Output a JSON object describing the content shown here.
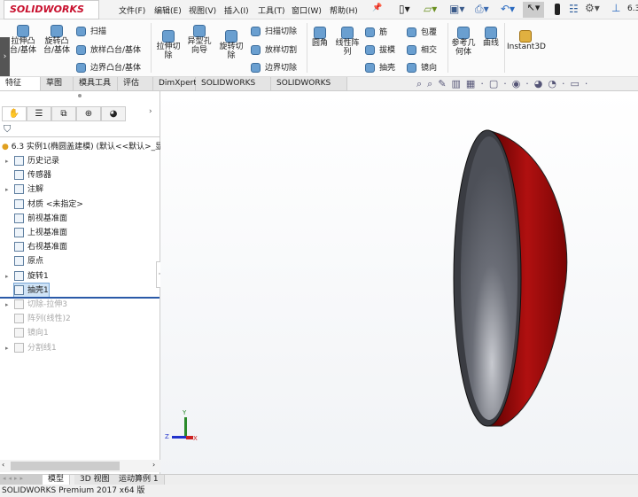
{
  "app": {
    "logo": "SOLIDWORKS",
    "doc_short": "6.3"
  },
  "menu": [
    "文件(F)",
    "编辑(E)",
    "视图(V)",
    "插入(I)",
    "工具(T)",
    "窗口(W)",
    "帮助(H)"
  ],
  "ribbon": {
    "large": [
      "拉伸凸台/基体",
      "旋转凸台/基体",
      "拉伸切除",
      "异型孔向导",
      "旋转切除",
      "圆角",
      "线性阵列",
      "参考几何体",
      "曲线",
      "Instant3D"
    ],
    "small1": [
      "扫描",
      "放样凸台/基体",
      "边界凸台/基体"
    ],
    "small2": [
      "扫描切除",
      "放样切割",
      "边界切除"
    ],
    "small3": [
      "筋",
      "拔模",
      "抽壳"
    ],
    "small4": [
      "包覆",
      "相交",
      "镜向"
    ]
  },
  "tabs": [
    "特征",
    "草图",
    "模具工具",
    "评估",
    "DimXpert",
    "SOLIDWORKS 插件",
    "SOLIDWORKS MBD"
  ],
  "tree": {
    "root": "6.3 实例1(椭圆盖建模) (默认<<默认>_显",
    "items": [
      {
        "label": "历史记录",
        "expand": true
      },
      {
        "label": "传感器"
      },
      {
        "label": "注解",
        "expand": true
      },
      {
        "label": "材质 <未指定>"
      },
      {
        "label": "前视基准面"
      },
      {
        "label": "上视基准面"
      },
      {
        "label": "右视基准面"
      },
      {
        "label": "原点"
      },
      {
        "label": "旋转1",
        "expand": true
      },
      {
        "label": "抽壳1",
        "selected": true
      },
      {
        "label": "切除-拉伸3",
        "expand": true,
        "dim": true
      },
      {
        "label": "阵列(线性)2",
        "dim": true
      },
      {
        "label": "镜向1",
        "dim": true
      },
      {
        "label": "分割线1",
        "expand": true,
        "dim": true
      }
    ]
  },
  "triad": {
    "x": "X",
    "y": "Y",
    "z": "Z"
  },
  "bottom_tabs": [
    "模型",
    "3D 视图",
    "运动算例 1"
  ],
  "status": "SOLIDWORKS Premium 2017 x64 版",
  "colors": {
    "part_red": "#9b0c0c",
    "face_grey": "#5a5d66"
  }
}
